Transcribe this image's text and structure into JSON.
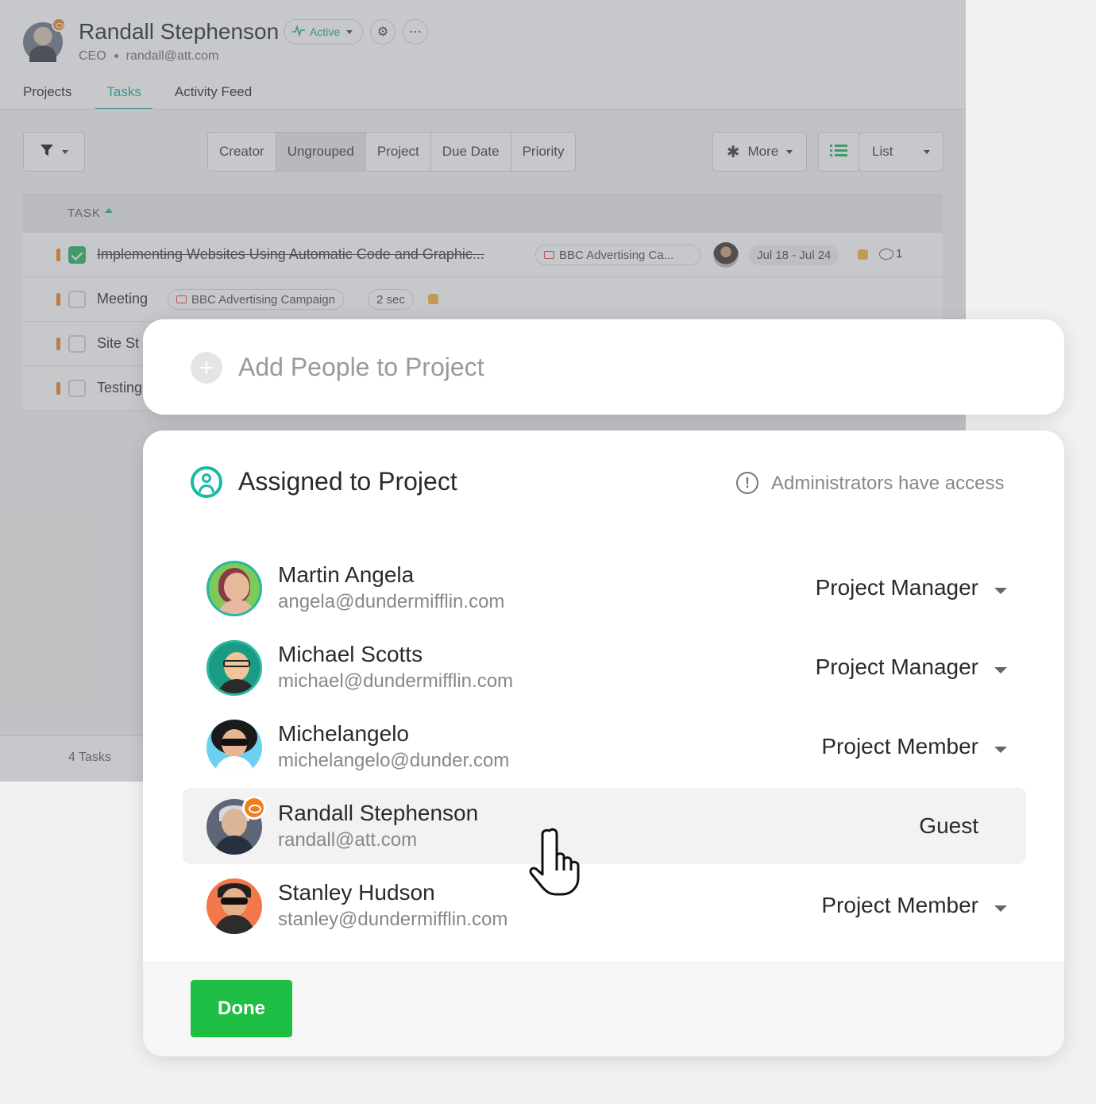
{
  "profile": {
    "name": "Randall Stephenson",
    "role": "CEO",
    "email": "randall@att.com",
    "status": "Active"
  },
  "tabs": [
    "Projects",
    "Tasks",
    "Activity Feed"
  ],
  "toolbar": {
    "group_options": [
      "Creator",
      "Ungrouped",
      "Project",
      "Due Date",
      "Priority"
    ],
    "group_selected": "Ungrouped",
    "more_label": "More",
    "view_label": "List"
  },
  "table": {
    "column_header": "TASK",
    "rows": [
      {
        "title": "Implementing Websites Using Automatic Code and Graphic...",
        "done": true,
        "project": "BBC Advertising Ca...",
        "dates": "Jul 18 - Jul 24",
        "comments": "1"
      },
      {
        "title": "Meeting",
        "done": false,
        "project": "BBC Advertising Campaign",
        "time": "2 sec"
      },
      {
        "title": "Site St",
        "done": false
      },
      {
        "title": "Testing",
        "done": false
      }
    ],
    "footer": "4 Tasks"
  },
  "add_people": {
    "label": "Add People to Project"
  },
  "assigned": {
    "title": "Assigned to Project",
    "info": "Administrators have access",
    "people": [
      {
        "name": "Martin Angela",
        "email": "angela@dundermifflin.com",
        "role": "Project Manager"
      },
      {
        "name": "Michael Scotts",
        "email": "michael@dundermifflin.com",
        "role": "Project Manager"
      },
      {
        "name": "Michelangelo",
        "email": "michelangelo@dunder.com",
        "role": "Project Member"
      },
      {
        "name": "Randall Stephenson",
        "email": "randall@att.com",
        "role": "Guest"
      },
      {
        "name": "Stanley Hudson",
        "email": "stanley@dundermifflin.com",
        "role": "Project Member"
      }
    ],
    "done_label": "Done"
  },
  "colors": {
    "accent": "#1aa89a",
    "done_button": "#1fbf45",
    "guest_badge": "#f07f1b",
    "priority": "#f07f1b"
  }
}
